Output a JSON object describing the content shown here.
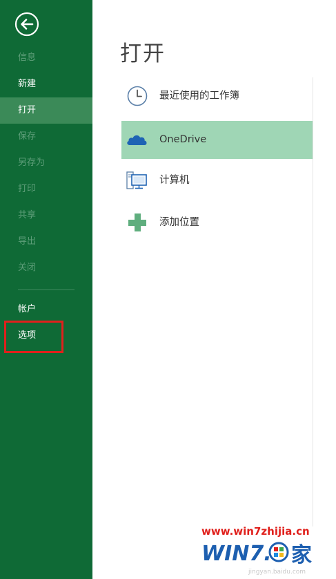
{
  "sidebar": {
    "items": [
      {
        "label": "信息",
        "state": "disabled"
      },
      {
        "label": "新建",
        "state": "normal"
      },
      {
        "label": "打开",
        "state": "active"
      },
      {
        "label": "保存",
        "state": "disabled"
      },
      {
        "label": "另存为",
        "state": "disabled"
      },
      {
        "label": "打印",
        "state": "disabled"
      },
      {
        "label": "共享",
        "state": "disabled"
      },
      {
        "label": "导出",
        "state": "disabled"
      },
      {
        "label": "关闭",
        "state": "disabled"
      },
      {
        "label": "帐户",
        "state": "normal"
      },
      {
        "label": "选项",
        "state": "normal"
      }
    ]
  },
  "main": {
    "title": "打开",
    "locations": [
      {
        "label": "最近使用的工作簿",
        "icon": "clock-icon"
      },
      {
        "label": "OneDrive",
        "icon": "cloud-icon",
        "selected": true
      },
      {
        "label": "计算机",
        "icon": "computer-icon"
      },
      {
        "label": "添加位置",
        "icon": "plus-icon"
      }
    ]
  },
  "watermark": {
    "url": "www.win7zhijia.cn",
    "logo_text": "WIN7",
    "logo_suffix": "家",
    "small_text": "jingyan.baidu.com"
  },
  "colors": {
    "sidebar": "#0f6a36",
    "sidebar_active": "#3b8a58",
    "selected_location": "#9fd6b5",
    "highlight": "#e0201c"
  }
}
